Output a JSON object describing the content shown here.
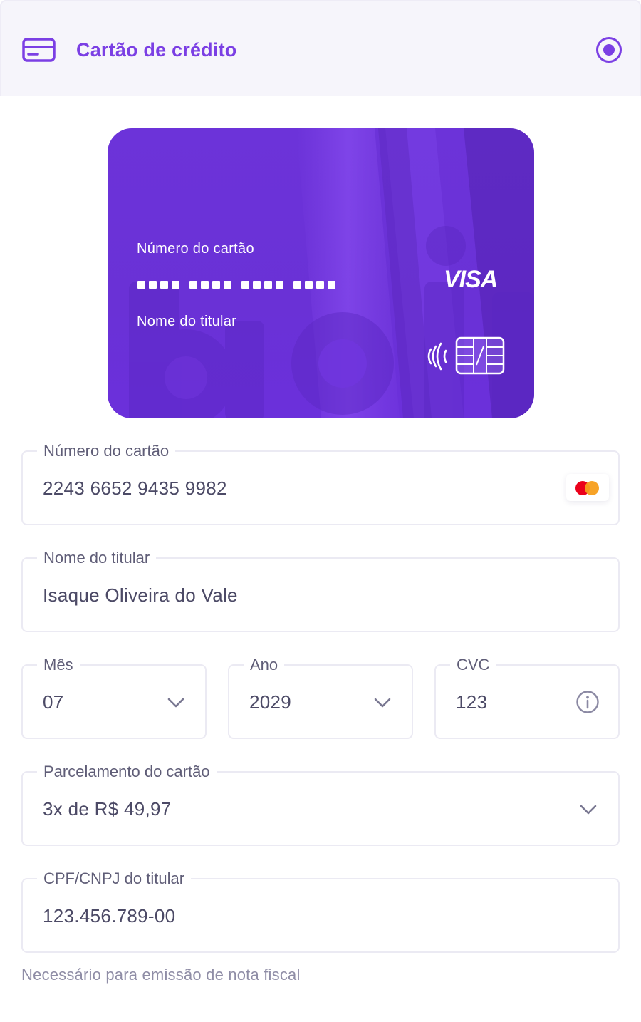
{
  "payment_option": {
    "icon": "credit-card-icon",
    "title": "Cartão de crédito",
    "selected": true,
    "accent_color": "#7b3fe4"
  },
  "card_preview": {
    "number_label": "Número do cartão",
    "number_mask": "•••• •••• •••• ••••",
    "holder_label": "Nome do titular",
    "brand": "VISA",
    "background_color": "#6a31d6",
    "watermark": "brain"
  },
  "form": {
    "card_number": {
      "label": "Número do cartão",
      "value": "2243 6652 9435 9982",
      "brand_icon": "mastercard-icon"
    },
    "holder_name": {
      "label": "Nome do titular",
      "value": "Isaque Oliveira do Vale"
    },
    "month": {
      "label": "Mês",
      "value": "07"
    },
    "year": {
      "label": "Ano",
      "value": "2029"
    },
    "cvc": {
      "label": "CVC",
      "value": "123",
      "icon": "info-icon"
    },
    "installments": {
      "label": "Parcelamento do cartão",
      "value": "3x de R$ 49,97"
    },
    "document": {
      "label": "CPF/CNPJ do titular",
      "value": "123.456.789-00",
      "helper": "Necessário para emissão de nota fiscal"
    }
  }
}
